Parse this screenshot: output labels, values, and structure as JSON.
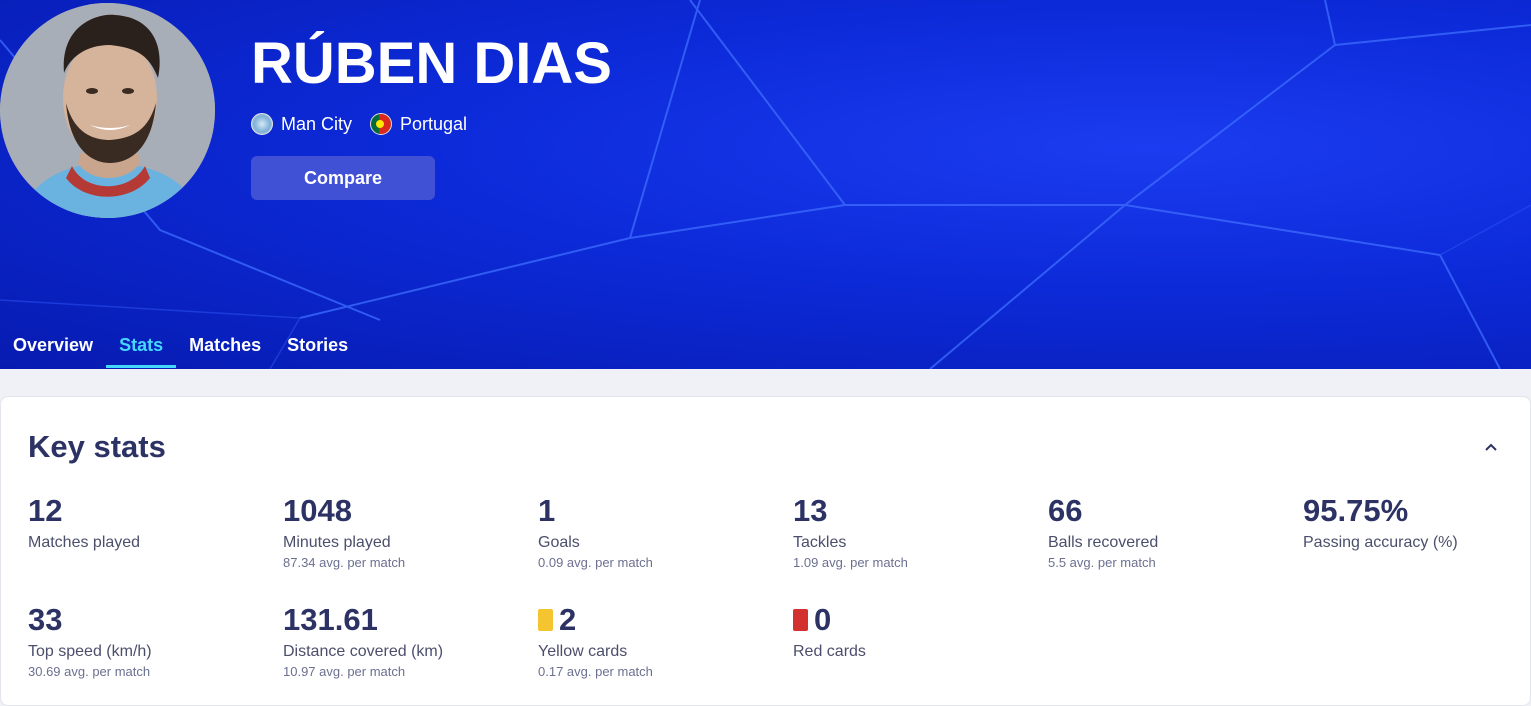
{
  "player": {
    "name": "RÚBEN DIAS",
    "club": "Man City",
    "country": "Portugal",
    "compare_label": "Compare"
  },
  "tabs": [
    {
      "label": "Overview",
      "active": false
    },
    {
      "label": "Stats",
      "active": true
    },
    {
      "label": "Matches",
      "active": false
    },
    {
      "label": "Stories",
      "active": false
    }
  ],
  "key_stats": {
    "title": "Key stats",
    "row1": [
      {
        "value": "12",
        "label": "Matches played",
        "avg": ""
      },
      {
        "value": "1048",
        "label": "Minutes played",
        "avg": "87.34 avg. per match"
      },
      {
        "value": "1",
        "label": "Goals",
        "avg": "0.09 avg. per match"
      },
      {
        "value": "13",
        "label": "Tackles",
        "avg": "1.09 avg. per match"
      },
      {
        "value": "66",
        "label": "Balls recovered",
        "avg": "5.5 avg. per match"
      },
      {
        "value": "95.75%",
        "label": "Passing accuracy (%)",
        "avg": ""
      }
    ],
    "row2": [
      {
        "value": "33",
        "label": "Top speed (km/h)",
        "avg": "30.69 avg. per match"
      },
      {
        "value": "131.61",
        "label": "Distance covered (km)",
        "avg": "10.97 avg. per match"
      },
      {
        "value": "2",
        "label": "Yellow cards",
        "avg": "0.17 avg. per match",
        "icon": "yellow-card-icon"
      },
      {
        "value": "0",
        "label": "Red cards",
        "avg": "",
        "icon": "red-card-icon"
      }
    ]
  },
  "colors": {
    "hero_blue": "#0c2ad8",
    "active_tab": "#44d8ff",
    "text_dark": "#2c3263",
    "yellow_card": "#f5c531",
    "red_card": "#d33030"
  }
}
